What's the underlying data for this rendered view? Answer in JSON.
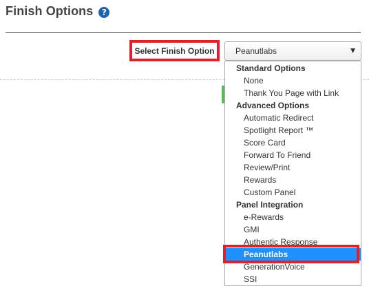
{
  "header": {
    "title": "Finish Options",
    "help_icon": "question-circle-icon",
    "help_glyph": "?"
  },
  "finish_option": {
    "label": "Select Finish Option",
    "selected_value": "Peanutlabs",
    "dropdown_glyph": "▼"
  },
  "dropdown": {
    "groups": [
      {
        "label": "Standard Options",
        "options": [
          "None",
          "Thank You Page with Link"
        ]
      },
      {
        "label": "Advanced Options",
        "options": [
          "Automatic Redirect",
          "Spotlight Report ™",
          "Score Card",
          "Forward To Friend",
          "Review/Print",
          "Rewards",
          "Custom Panel"
        ]
      },
      {
        "label": "Panel Integration",
        "options": [
          "e-Rewards",
          "GMI",
          "Authentic Response",
          "Peanutlabs",
          "GenerationVoice",
          "SSI"
        ]
      }
    ]
  },
  "colors": {
    "highlight_border": "#e0202a",
    "selected_bg": "#1e90ff",
    "help_icon_bg": "#1e63b0",
    "green_marker": "#5cb85c"
  }
}
